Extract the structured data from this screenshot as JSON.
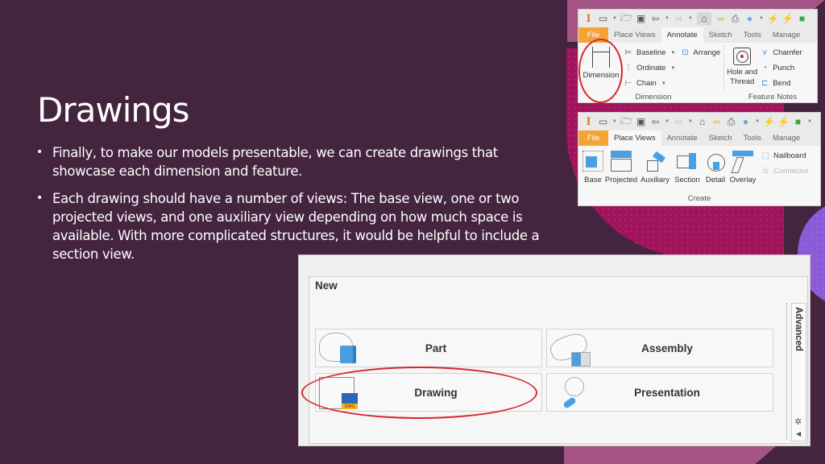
{
  "slide": {
    "title": "Drawings",
    "bullets": [
      "Finally, to make our models presentable, we can create drawings that showcase each dimension and feature.",
      "Each drawing should have a number of views: The base view, one or two projected views, and one auxiliary view depending on how much space is available. With more complicated structures, it would be helpful to include a section view."
    ],
    "bullet_glyph": "•"
  },
  "colors": {
    "slide_background": "#44243f",
    "accent_magenta": "#a0145c",
    "accent_mauve": "#a35484",
    "accent_purple": "#8a5bd6",
    "annotation_red": "#d7262b",
    "file_tab_orange": "#f5a332",
    "icon_blue": "#4a9fe0"
  },
  "ribbon_annotate": {
    "quick_access_icons": [
      "inventor-logo-icon",
      "new-file-icon",
      "open-folder-icon",
      "save-icon",
      "undo-icon",
      "redo-icon",
      "home-icon",
      "measure-icon",
      "print-icon",
      "color-override-icon",
      "update-icon",
      "update-all-icon",
      "export-icon"
    ],
    "tabs": [
      "File",
      "Place Views",
      "Annotate",
      "Sketch",
      "Tools",
      "Manage"
    ],
    "active_tab": "Annotate",
    "dimension_group": {
      "label": "Dimension",
      "big_button": "Dimension",
      "items": [
        {
          "label": "Baseline",
          "has_dropdown": true
        },
        {
          "label": "Ordinate",
          "has_dropdown": true
        },
        {
          "label": "Chain",
          "has_dropdown": true
        }
      ],
      "arrange": "Arrange"
    },
    "feature_notes_group": {
      "label": "Feature Notes",
      "big_button": "Hole and Thread",
      "items": [
        "Chamfer",
        "Punch",
        "Bend"
      ]
    }
  },
  "ribbon_place_views": {
    "tabs": [
      "File",
      "Place Views",
      "Annotate",
      "Sketch",
      "Tools",
      "Manage"
    ],
    "active_tab": "Place Views",
    "create_group": {
      "label": "Create",
      "buttons": [
        "Base",
        "Projected",
        "Auxiliary",
        "Section",
        "Detail",
        "Overlay"
      ],
      "small_items": [
        {
          "label": "Nailboard",
          "enabled": true
        },
        {
          "label": "Connector",
          "enabled": false
        }
      ]
    }
  },
  "new_dialog": {
    "title": "New",
    "tiles": [
      "Part",
      "Assembly",
      "Drawing",
      "Presentation"
    ],
    "highlighted_tile": "Drawing",
    "side_tab": "Advanced"
  }
}
